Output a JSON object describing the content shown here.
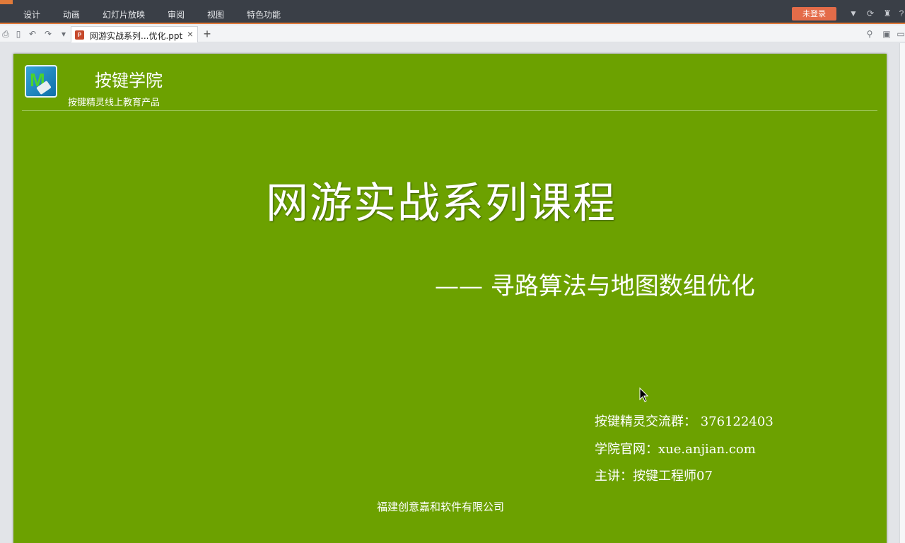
{
  "menubar": {
    "items": [
      "设计",
      "动画",
      "幻灯片放映",
      "审阅",
      "视图",
      "特色功能"
    ],
    "login_label": "未登录"
  },
  "toolbar": {
    "tab_label": "网游实战系列...优化.ppt",
    "tab_close": "×",
    "add_tab": "+"
  },
  "slide": {
    "brand_title": "按键学院",
    "brand_subtitle": "按键精灵线上教育产品",
    "main_title": "网游实战系列课程",
    "subtitle": "—— 寻路算法与地图数组优化",
    "info": [
      "按键精灵交流群： 376122403",
      "学院官网：xue.anjian.com",
      "主讲：按键工程师07"
    ],
    "company": "福建创意嘉和软件有限公司"
  },
  "colors": {
    "slide_bg": "#6ca100",
    "menubar_bg": "#3a3f47",
    "accent": "#e07a3a",
    "login_bg": "#e46c49"
  }
}
